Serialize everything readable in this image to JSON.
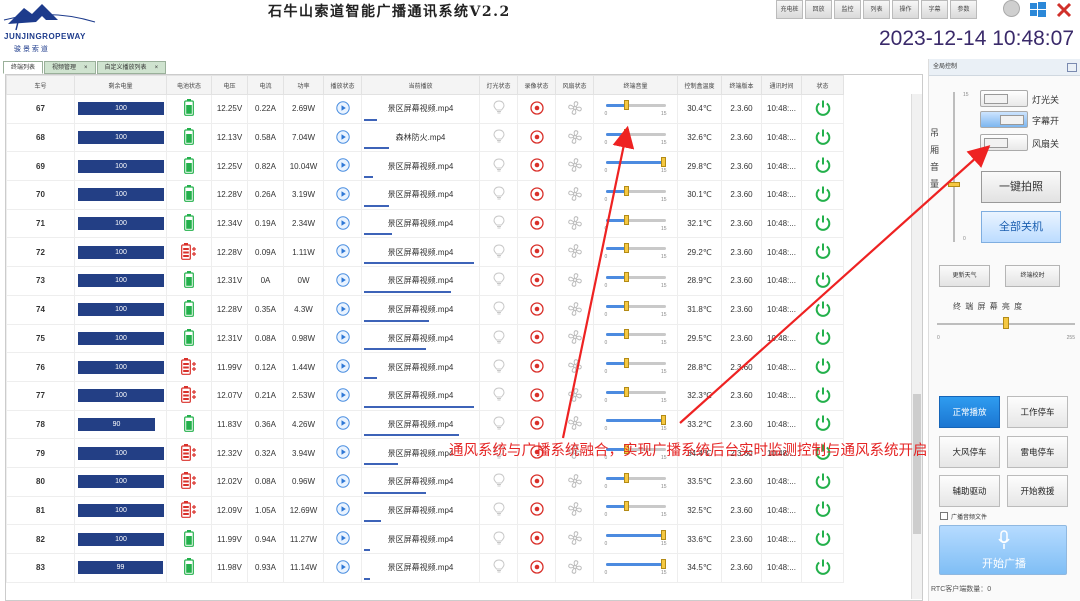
{
  "app": {
    "title": "石牛山索道智能广播通讯系统V2.2",
    "logo_text": "JUNJINGROPEWAY",
    "logo_sub": "骏 景 索 道",
    "clock": "2023-12-14 10:48:07"
  },
  "topbar": {
    "buttons": [
      "充电桩",
      "回放",
      "监控",
      "列表",
      "操作",
      "字幕",
      "参数"
    ]
  },
  "tabs": [
    {
      "label": "终端列表"
    },
    {
      "label": "视频管理",
      "close": "×"
    },
    {
      "label": "自定义播放列表",
      "close": "×"
    }
  ],
  "table": {
    "headers": [
      "车号",
      "剩余电量",
      "电池状态",
      "电压",
      "电流",
      "功率",
      "播放状态",
      "当前播放",
      "灯光状态",
      "录像状态",
      "风扇状态",
      "终端音量",
      "控制盒温度",
      "终端版本",
      "通讯时间",
      "状态"
    ],
    "volume_min": "0",
    "volume_max": "15",
    "rows": [
      {
        "car": "67",
        "battery": "100",
        "charging": false,
        "voltage": "12.25V",
        "current": "0.22A",
        "power": "2.69W",
        "file": "景区屏幕视频.mp4",
        "progress": 0.12,
        "volume": 0.35,
        "temp": "30.4℃",
        "version": "2.3.60",
        "time": "10:48:..."
      },
      {
        "car": "68",
        "battery": "100",
        "charging": false,
        "voltage": "12.13V",
        "current": "0.58A",
        "power": "7.04W",
        "file": "森林防火.mp4",
        "progress": 0.22,
        "volume": 0.35,
        "temp": "32.6℃",
        "version": "2.3.60",
        "time": "10:48:..."
      },
      {
        "car": "69",
        "battery": "100",
        "charging": false,
        "voltage": "12.25V",
        "current": "0.82A",
        "power": "10.04W",
        "file": "景区屏幕视频.mp4",
        "progress": 0.08,
        "volume": 1.0,
        "temp": "29.8℃",
        "version": "2.3.60",
        "time": "10:48:..."
      },
      {
        "car": "70",
        "battery": "100",
        "charging": false,
        "voltage": "12.28V",
        "current": "0.26A",
        "power": "3.19W",
        "file": "景区屏幕视频.mp4",
        "progress": 0.22,
        "volume": 0.35,
        "temp": "30.1℃",
        "version": "2.3.60",
        "time": "10:48:..."
      },
      {
        "car": "71",
        "battery": "100",
        "charging": false,
        "voltage": "12.34V",
        "current": "0.19A",
        "power": "2.34W",
        "file": "景区屏幕视频.mp4",
        "progress": 0.25,
        "volume": 0.35,
        "temp": "32.1℃",
        "version": "2.3.60",
        "time": "10:48:..."
      },
      {
        "car": "72",
        "battery": "100",
        "charging": true,
        "voltage": "12.28V",
        "current": "0.09A",
        "power": "1.11W",
        "file": "景区屏幕视频.mp4",
        "progress": 0.98,
        "volume": 0.35,
        "temp": "29.2℃",
        "version": "2.3.60",
        "time": "10:48:..."
      },
      {
        "car": "73",
        "battery": "100",
        "charging": false,
        "voltage": "12.31V",
        "current": "0A",
        "power": "0W",
        "file": "景区屏幕视频.mp4",
        "progress": 0.78,
        "volume": 0.35,
        "temp": "28.9℃",
        "version": "2.3.60",
        "time": "10:48:..."
      },
      {
        "car": "74",
        "battery": "100",
        "charging": false,
        "voltage": "12.28V",
        "current": "0.35A",
        "power": "4.3W",
        "file": "景区屏幕视频.mp4",
        "progress": 0.58,
        "volume": 0.35,
        "temp": "31.8℃",
        "version": "2.3.60",
        "time": "10:48:..."
      },
      {
        "car": "75",
        "battery": "100",
        "charging": false,
        "voltage": "12.31V",
        "current": "0.08A",
        "power": "0.98W",
        "file": "景区屏幕视频.mp4",
        "progress": 0.55,
        "volume": 0.35,
        "temp": "29.5℃",
        "version": "2.3.60",
        "time": "10:48:..."
      },
      {
        "car": "76",
        "battery": "100",
        "charging": true,
        "voltage": "11.99V",
        "current": "0.12A",
        "power": "1.44W",
        "file": "景区屏幕视频.mp4",
        "progress": 0.12,
        "volume": 0.35,
        "temp": "28.8℃",
        "version": "2.3.60",
        "time": "10:48:..."
      },
      {
        "car": "77",
        "battery": "100",
        "charging": true,
        "voltage": "12.07V",
        "current": "0.21A",
        "power": "2.53W",
        "file": "景区屏幕视频.mp4",
        "progress": 0.98,
        "volume": 0.35,
        "temp": "32.3℃",
        "version": "2.3.60",
        "time": "10:48:..."
      },
      {
        "car": "78",
        "battery": "90",
        "charging": false,
        "voltage": "11.83V",
        "current": "0.36A",
        "power": "4.26W",
        "file": "景区屏幕视频.mp4",
        "progress": 0.85,
        "volume": 1.0,
        "temp": "33.2℃",
        "version": "2.3.60",
        "time": "10:48:..."
      },
      {
        "car": "79",
        "battery": "100",
        "charging": true,
        "voltage": "12.32V",
        "current": "0.32A",
        "power": "3.94W",
        "file": "景区屏幕视频.mp4",
        "progress": 0.3,
        "volume": 0.35,
        "temp": "34.4℃",
        "version": "2.3.60",
        "time": "10:48:..."
      },
      {
        "car": "80",
        "battery": "100",
        "charging": true,
        "voltage": "12.02V",
        "current": "0.08A",
        "power": "0.96W",
        "file": "景区屏幕视频.mp4",
        "progress": 0.55,
        "volume": 0.35,
        "temp": "33.5℃",
        "version": "2.3.60",
        "time": "10:48:..."
      },
      {
        "car": "81",
        "battery": "100",
        "charging": true,
        "voltage": "12.09V",
        "current": "1.05A",
        "power": "12.69W",
        "file": "景区屏幕视频.mp4",
        "progress": 0.15,
        "volume": 0.35,
        "temp": "32.5℃",
        "version": "2.3.60",
        "time": "10:48:..."
      },
      {
        "car": "82",
        "battery": "100",
        "charging": false,
        "voltage": "11.99V",
        "current": "0.94A",
        "power": "11.27W",
        "file": "景区屏幕视频.mp4",
        "progress": 0.05,
        "volume": 1.0,
        "temp": "33.6℃",
        "version": "2.3.60",
        "time": "10:48:..."
      },
      {
        "car": "83",
        "battery": "99",
        "charging": false,
        "voltage": "11.98V",
        "current": "0.93A",
        "power": "11.14W",
        "file": "景区屏幕视频.mp4",
        "progress": 0.05,
        "volume": 1.0,
        "temp": "34.5℃",
        "version": "2.3.60",
        "time": "10:48:..."
      }
    ]
  },
  "right_panel": {
    "header": "全局控制",
    "vol_label": "吊 厢 音 量",
    "vol_max": "15",
    "vol_min": "0",
    "toggles": [
      {
        "label": "灯光关",
        "on": false
      },
      {
        "label": "字幕开",
        "on": true
      },
      {
        "label": "风扇关",
        "on": false
      }
    ],
    "photo_button": "一键拍照",
    "shutdown_button": "全部关机",
    "weather_button": "更新天气",
    "time_button": "终端校时",
    "brightness_label": "终 端 屏 幕 亮 度",
    "brightness_min": "0",
    "brightness_max": "255",
    "brightness": 0.5,
    "ctrl_buttons": [
      "正常播放",
      "工作停车",
      "大风停车",
      "雷电停车",
      "辅助驱动",
      "开始救援"
    ],
    "broadcast_file_label": "广播音频文件",
    "broadcast_button": "开始广播",
    "rtc_label": "RTC客户端数量：0"
  },
  "annotation": "通风系统与广播系统融合，实现广播系统后台实时监测控制与通风系统开启",
  "colors": {
    "battery_bar": "#233f85",
    "accent_blue": "#1b76d2",
    "annotation_red": "#e52525",
    "power_green": "#23b04b",
    "record_red": "#d9302a"
  }
}
